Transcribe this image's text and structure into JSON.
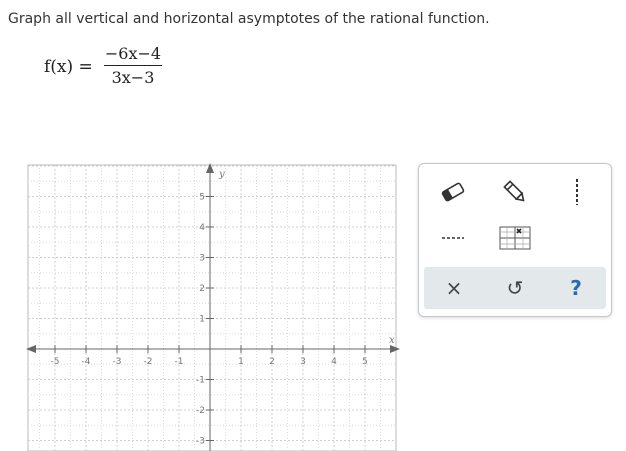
{
  "prompt": "Graph all vertical and horizontal asymptotes of the rational function.",
  "formula": {
    "lhs": "f(x) =",
    "numerator": "−6x−4",
    "denominator": "3x−3"
  },
  "graph": {
    "x_axis_label": "x",
    "y_axis_label": "y",
    "x_ticks": [
      "-5",
      "-4",
      "-3",
      "-2",
      "-1",
      "1",
      "2",
      "3",
      "4",
      "5"
    ],
    "y_ticks": [
      "5",
      "4",
      "3",
      "2",
      "1",
      "-1",
      "-2",
      "-3"
    ]
  },
  "toolbar": {
    "tools": [
      "eraser-icon",
      "pencil-icon",
      "more-options-icon",
      "dashed-line-icon",
      "grid-move-icon"
    ],
    "actions": {
      "clear": "×",
      "undo": "↺",
      "help": "?"
    }
  }
}
